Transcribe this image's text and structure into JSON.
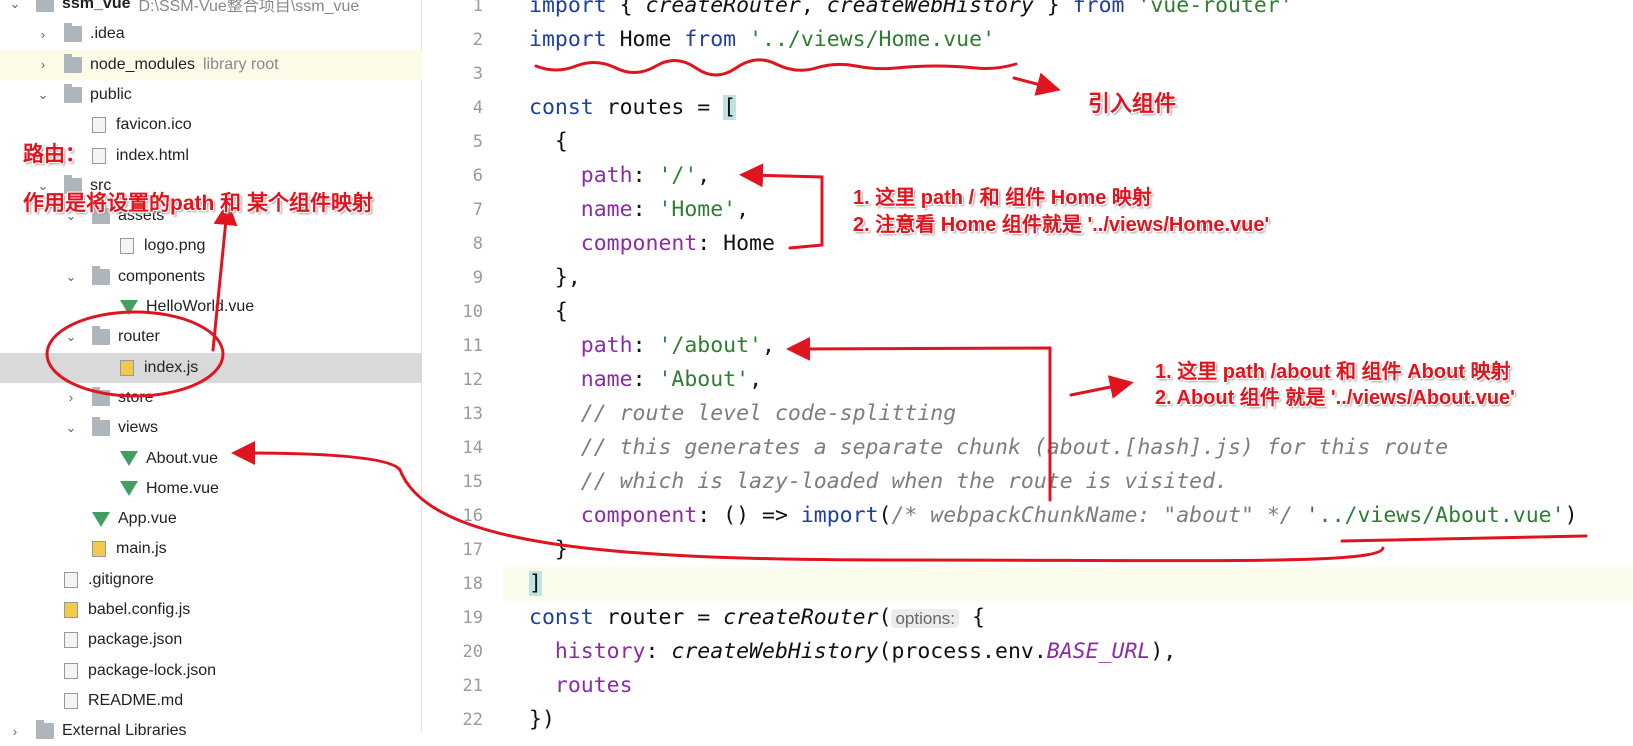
{
  "project_tree": [
    {
      "label": "ssm_vue",
      "extra": "D:\\SSM-Vue整合项目\\ssm_vue",
      "depth": 0,
      "type": "folder",
      "state": "expanded",
      "bold": true
    },
    {
      "label": ".idea",
      "depth": 1,
      "type": "folder",
      "state": "collapsed"
    },
    {
      "label": "node_modules",
      "extra": "library root",
      "depth": 1,
      "type": "folder",
      "state": "collapsed",
      "lib": true
    },
    {
      "label": "public",
      "depth": 1,
      "type": "folder",
      "state": "expanded"
    },
    {
      "label": "favicon.ico",
      "depth": 2,
      "type": "file"
    },
    {
      "label": "index.html",
      "depth": 2,
      "type": "file"
    },
    {
      "label": "src",
      "depth": 1,
      "type": "folder",
      "state": "expanded"
    },
    {
      "label": "assets",
      "depth": 2,
      "type": "folder",
      "state": "expanded"
    },
    {
      "label": "logo.png",
      "depth": 3,
      "type": "file"
    },
    {
      "label": "components",
      "depth": 2,
      "type": "folder",
      "state": "expanded"
    },
    {
      "label": "HelloWorld.vue",
      "depth": 3,
      "type": "vue"
    },
    {
      "label": "router",
      "depth": 2,
      "type": "folder",
      "state": "expanded"
    },
    {
      "label": "index.js",
      "depth": 3,
      "type": "js",
      "selected": true
    },
    {
      "label": "store",
      "depth": 2,
      "type": "folder",
      "state": "collapsed"
    },
    {
      "label": "views",
      "depth": 2,
      "type": "folder",
      "state": "expanded"
    },
    {
      "label": "About.vue",
      "depth": 3,
      "type": "vue"
    },
    {
      "label": "Home.vue",
      "depth": 3,
      "type": "vue"
    },
    {
      "label": "App.vue",
      "depth": 2,
      "type": "vue"
    },
    {
      "label": "main.js",
      "depth": 2,
      "type": "js"
    },
    {
      "label": ".gitignore",
      "depth": 1,
      "type": "file"
    },
    {
      "label": "babel.config.js",
      "depth": 1,
      "type": "js"
    },
    {
      "label": "package.json",
      "depth": 1,
      "type": "file"
    },
    {
      "label": "package-lock.json",
      "depth": 1,
      "type": "file"
    },
    {
      "label": "README.md",
      "depth": 1,
      "type": "file"
    },
    {
      "label": "External Libraries",
      "depth": 0,
      "type": "folder",
      "state": "collapsed"
    }
  ],
  "code_lines": [
    [
      [
        "import ",
        "kw"
      ],
      [
        "{ ",
        ""
      ],
      [
        "createRouter",
        "fn"
      ],
      [
        ", ",
        ""
      ],
      [
        "createWebHistory",
        "fn"
      ],
      [
        " } ",
        ""
      ],
      [
        "from ",
        "kw"
      ],
      [
        "'vue-router'",
        "str"
      ]
    ],
    [
      [
        "import ",
        "kw"
      ],
      [
        "Home ",
        ""
      ],
      [
        "from ",
        "kw"
      ],
      [
        "'../views/Home.vue'",
        "str"
      ]
    ],
    [],
    [
      [
        "const ",
        "kw"
      ],
      [
        "routes = ",
        ""
      ],
      [
        "[",
        "br"
      ]
    ],
    [
      [
        "  {",
        ""
      ]
    ],
    [
      [
        "    ",
        ""
      ],
      [
        "path",
        "prop"
      ],
      [
        ": ",
        ""
      ],
      [
        "'/'",
        "str"
      ],
      [
        ",",
        ""
      ]
    ],
    [
      [
        "    ",
        ""
      ],
      [
        "name",
        "prop"
      ],
      [
        ": ",
        ""
      ],
      [
        "'Home'",
        "str"
      ],
      [
        ",",
        ""
      ]
    ],
    [
      [
        "    ",
        ""
      ],
      [
        "component",
        "prop"
      ],
      [
        ": Home",
        ""
      ]
    ],
    [
      [
        "  },",
        ""
      ]
    ],
    [
      [
        "  {",
        ""
      ]
    ],
    [
      [
        "    ",
        ""
      ],
      [
        "path",
        "prop"
      ],
      [
        ": ",
        ""
      ],
      [
        "'/about'",
        "str"
      ],
      [
        ",",
        ""
      ]
    ],
    [
      [
        "    ",
        ""
      ],
      [
        "name",
        "prop"
      ],
      [
        ": ",
        ""
      ],
      [
        "'About'",
        "str"
      ],
      [
        ",",
        ""
      ]
    ],
    [
      [
        "    ",
        ""
      ],
      [
        "// route level code-splitting",
        "cm"
      ]
    ],
    [
      [
        "    ",
        ""
      ],
      [
        "// this generates a separate chunk (about.[hash].js) for this route",
        "cm"
      ]
    ],
    [
      [
        "    ",
        ""
      ],
      [
        "// which is lazy-loaded when the route is visited.",
        "cm"
      ]
    ],
    [
      [
        "    ",
        ""
      ],
      [
        "component",
        "prop"
      ],
      [
        ": () => ",
        ""
      ],
      [
        "import",
        "kw"
      ],
      [
        "(",
        ""
      ],
      [
        "/* webpackChunkName: \"about\" */ ",
        "cm"
      ],
      [
        "'../views/About.vue'",
        "str"
      ],
      [
        ")",
        ""
      ]
    ],
    [
      [
        "  }",
        ""
      ]
    ],
    [
      [
        "]",
        "br"
      ]
    ],
    [
      [
        "const ",
        "kw"
      ],
      [
        "router = ",
        ""
      ],
      [
        "createRouter",
        "fn"
      ],
      [
        "(",
        ""
      ],
      [
        "options:",
        "hint"
      ],
      [
        " {",
        ""
      ]
    ],
    [
      [
        "  ",
        ""
      ],
      [
        "history",
        "prop"
      ],
      [
        ": ",
        ""
      ],
      [
        "createWebHistory",
        "fn"
      ],
      [
        "(process.env.",
        ""
      ],
      [
        "BASE_URL",
        "const"
      ],
      [
        "),",
        ""
      ]
    ],
    [
      [
        "  ",
        ""
      ],
      [
        "routes",
        "prop"
      ]
    ],
    [
      [
        "})",
        ""
      ]
    ]
  ],
  "highlighted_line": 18,
  "annotations": {
    "import_note": "引入组件",
    "router_title": "路由：",
    "router_desc": "作用是将设置的path 和 某个组件映射",
    "home_note_1": "1. 这里 path / 和 组件 Home 映射",
    "home_note_2": "2. 注意看 Home 组件就是 '../views/Home.vue'",
    "about_note_1": "1. 这里 path /about 和 组件 About 映射",
    "about_note_2": "2. About 组件 就是 '../views/About.vue'"
  },
  "colors": {
    "annotation": "#e0141e",
    "keyword": "#1d3fa4",
    "string": "#2f7d32",
    "property": "#8a2ca8",
    "selection": "#d9d9d9"
  }
}
